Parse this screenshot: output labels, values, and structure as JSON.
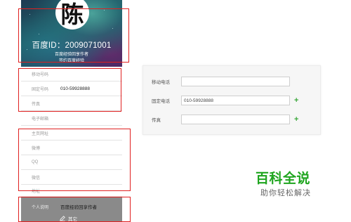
{
  "profile": {
    "avatar_char": "陈",
    "baidu_id": "百度ID：2009071001",
    "role": "百度经验回享作者",
    "signed": "签约百度经验"
  },
  "fields": [
    {
      "label": "移动号码",
      "value": ""
    },
    {
      "label": "固定号码",
      "value": "010-59928888"
    },
    {
      "label": "传真",
      "value": ""
    },
    {
      "label": "电子邮箱",
      "value": ""
    },
    {
      "label": "主页网址",
      "value": ""
    },
    {
      "label": "微博",
      "value": ""
    },
    {
      "label": "QQ",
      "value": ""
    },
    {
      "label": "微信",
      "value": ""
    },
    {
      "label": "地址",
      "value": ""
    }
  ],
  "personal": {
    "label": "个人说明",
    "value": "百度经验回享作者"
  },
  "edit_label": "其它",
  "edit_icon": "pencil-icon",
  "edit_panel": {
    "mobile_label": "移动电话",
    "mobile_value": "",
    "fixed_label": "固定电话",
    "fixed_value": "010-59928888",
    "fax_label": "传真",
    "fax_value": "",
    "add_symbol": "+"
  },
  "watermark": {
    "main": "百科全说",
    "sub": "助你轻松解决"
  },
  "colors": {
    "highlight": "#e02020",
    "add_green": "#3aa83a",
    "logo_green": "#1fa51f",
    "dark_row": "#8a8a8a"
  }
}
